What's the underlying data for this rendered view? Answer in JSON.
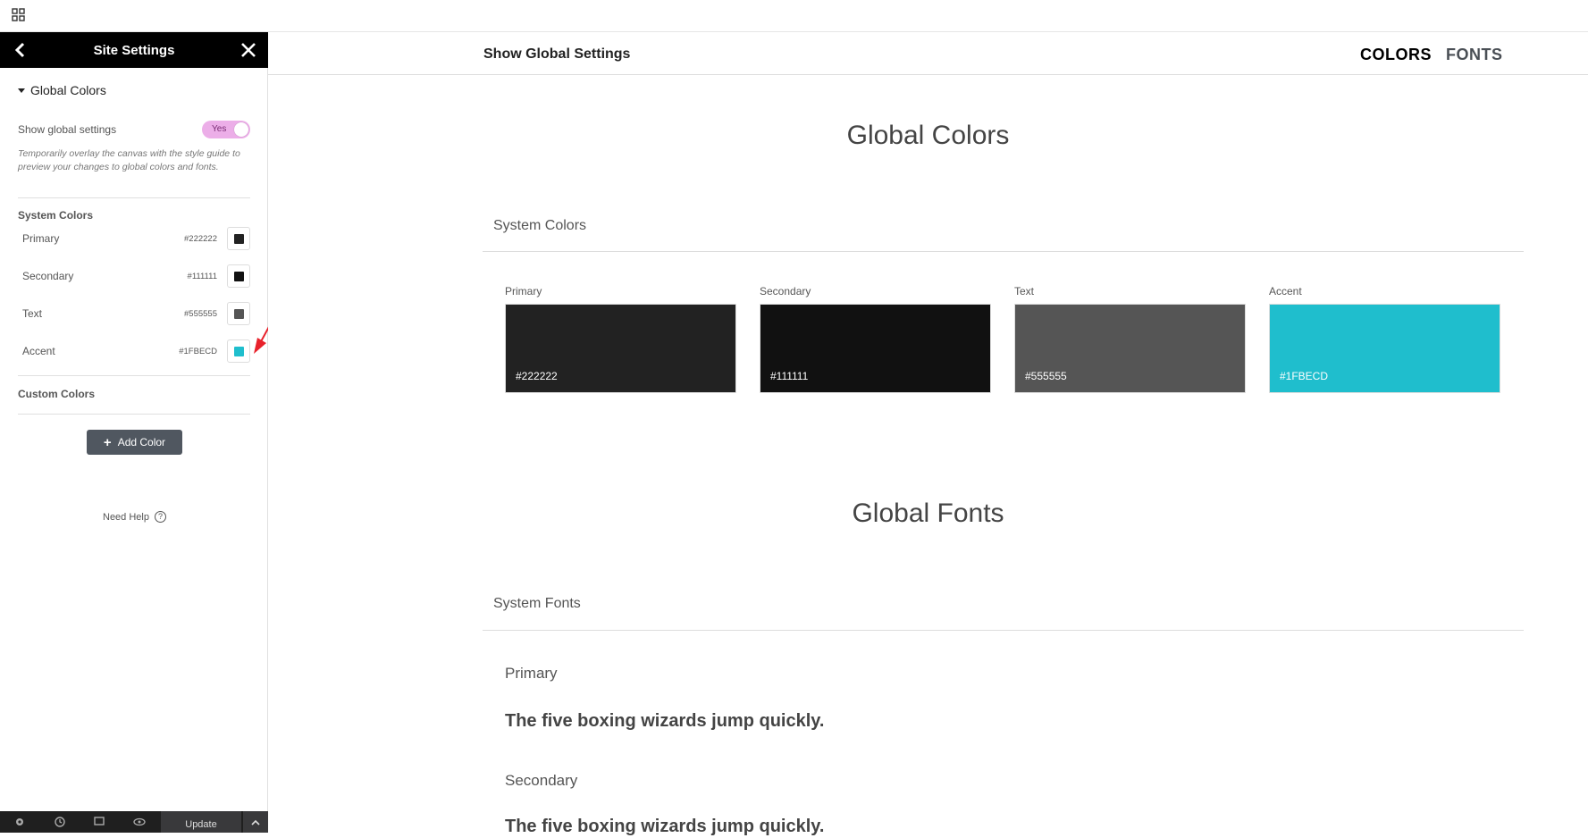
{
  "sidebar": {
    "title": "Site Settings",
    "section": "Global Colors",
    "show_global_label": "Show global settings",
    "toggle_label": "Yes",
    "note": "Temporarily overlay the canvas with the style guide to preview your changes to global colors and fonts.",
    "system_colors_title": "System Colors",
    "system_colors": [
      {
        "name": "Primary",
        "hex": "#222222",
        "color": "#222222"
      },
      {
        "name": "Secondary",
        "hex": "#111111",
        "color": "#111111"
      },
      {
        "name": "Text",
        "hex": "#555555",
        "color": "#555555"
      },
      {
        "name": "Accent",
        "hex": "#1FBECD",
        "color": "#1FBECD"
      }
    ],
    "custom_colors_title": "Custom Colors",
    "add_color_label": "Add Color",
    "need_help_label": "Need Help",
    "update_label": "Update"
  },
  "main": {
    "title": "Show Global Settings",
    "tabs": [
      "COLORS",
      "FONTS"
    ],
    "global_colors_title": "Global Colors",
    "system_colors_title": "System Colors",
    "color_cards": [
      {
        "name": "Primary",
        "hex": "#222222",
        "color": "#222222"
      },
      {
        "name": "Secondary",
        "hex": "#111111",
        "color": "#111111"
      },
      {
        "name": "Text",
        "hex": "#555555",
        "color": "#555555"
      },
      {
        "name": "Accent",
        "hex": "#1FBECD",
        "color": "#1FBECD"
      }
    ],
    "global_fonts_title": "Global Fonts",
    "system_fonts_title": "System Fonts",
    "fonts": [
      {
        "name": "Primary",
        "sample": "The five boxing wizards jump quickly."
      },
      {
        "name": "Secondary",
        "sample": "The five boxing wizards jump quickly."
      }
    ]
  },
  "icons": {
    "top_left": "grid-icon",
    "back": "chevron-left-icon",
    "close": "close-icon",
    "help": "question-circle-icon",
    "bottom": [
      "settings-icon",
      "history-icon",
      "responsive-icon",
      "eye-icon",
      "chevron-up-icon"
    ]
  },
  "annotation_color": "#e8212b"
}
